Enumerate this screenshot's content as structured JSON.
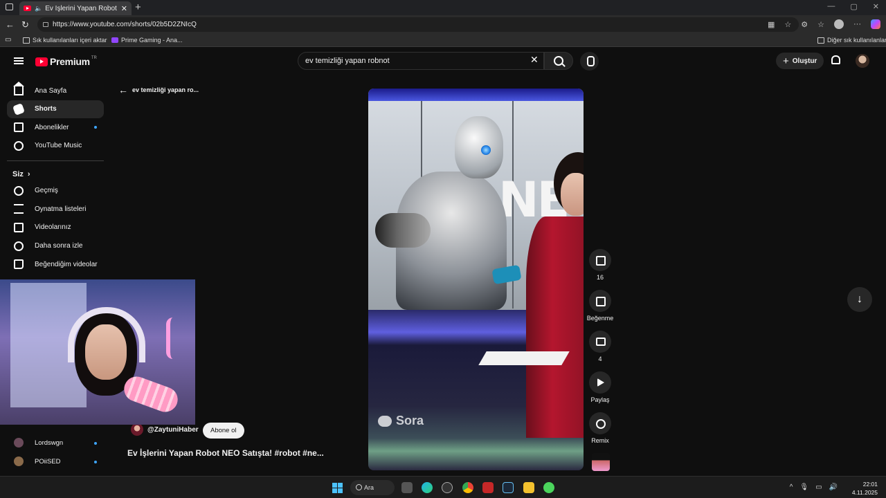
{
  "browser": {
    "tab_title": "Ev İşlerini Yapan Robot NEO",
    "tab_close": "✕",
    "new_tab": "+",
    "url": "https://www.youtube.com/shorts/02b5D2ZNIcQ",
    "window_controls": [
      "—",
      "▢",
      "✕"
    ],
    "bookmarks": [
      {
        "label": "Sık kullanılanları içeri aktar",
        "icon": "folder-icon"
      },
      {
        "label": "Prime Gaming - Ana...",
        "icon": "prime-gaming-icon"
      }
    ],
    "other_bookmarks": "Diğer sık kullanılanlar"
  },
  "header": {
    "logo_text": "Premium",
    "country": "TR",
    "search_value": "ev temizliği yapan robnot",
    "clear": "✕",
    "create_label": "Oluştur",
    "create_plus": "+"
  },
  "sidebar": {
    "main": [
      {
        "label": "Ana Sayfa",
        "icon": "home-icon"
      },
      {
        "label": "Shorts",
        "icon": "shorts-icon",
        "active": true
      },
      {
        "label": "Abonelikler",
        "icon": "subscriptions-icon"
      },
      {
        "label": "YouTube Music",
        "icon": "youtube-music-icon"
      }
    ],
    "you_heading": "Siz",
    "you_chevron": "›",
    "you": [
      {
        "label": "Geçmiş",
        "icon": "history-icon"
      },
      {
        "label": "Oynatma listeleri",
        "icon": "playlist-icon"
      },
      {
        "label": "Videolarınız",
        "icon": "your-videos-icon"
      },
      {
        "label": "Daha sonra izle",
        "icon": "watch-later-icon"
      },
      {
        "label": "Beğendiğim videolar",
        "icon": "liked-icon"
      }
    ],
    "subscriptions": [
      {
        "label": "Lordswgn"
      },
      {
        "label": "POiiSED"
      }
    ]
  },
  "short": {
    "back_label": "ev temizliği yapan ro...",
    "back_arrow": "←",
    "video_overlay_text": "NE",
    "watermark": "Sora",
    "channel": "@ZaytuniHaber",
    "subscribe_label": "Abone ol",
    "title": "Ev İşlerini Yapan Robot NEO Satışta! #robot #ne...",
    "actions": {
      "like_count": "16",
      "dislike_label": "Beğenme",
      "comment_count": "4",
      "share_label": "Paylaş",
      "remix_label": "Remix"
    },
    "next_arrow": "↓"
  },
  "taskbar": {
    "search_label": "Ara",
    "tray_caret": "^",
    "time": "22:01",
    "date": "4.11.2025"
  },
  "colors": {
    "youtube_red": "#ff0033",
    "background": "#0f0f0f",
    "accent_blue": "#3ea6ff"
  }
}
